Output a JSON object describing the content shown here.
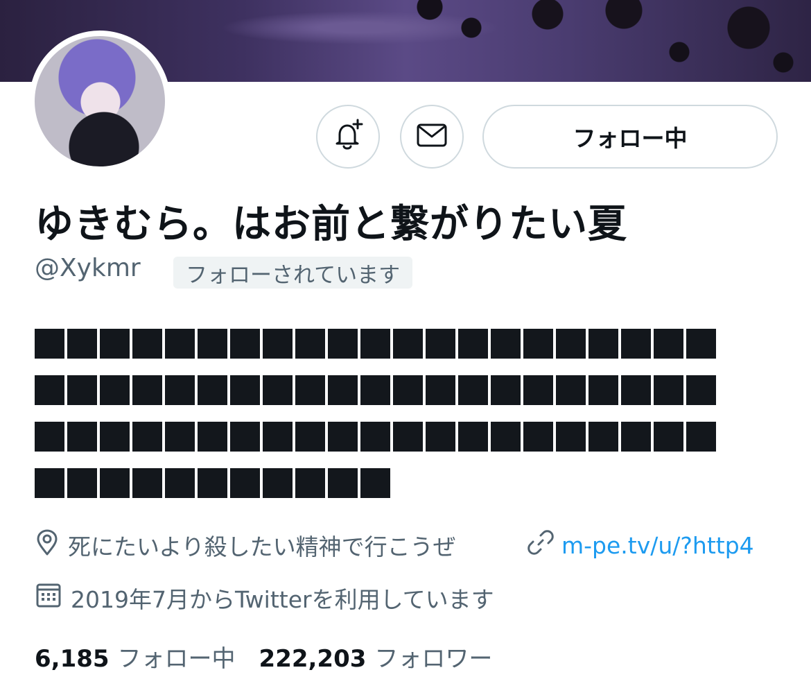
{
  "profile": {
    "display_name": "ゆきむら。はお前と繋がりたい夏",
    "handle": "@Xykmr",
    "follows_you_badge": "フォローされています",
    "bio_redacted_lines": [
      21,
      21,
      21,
      11
    ],
    "location": "死にたいより殺したい精神で行こうぜ",
    "url": "m-pe.tv/u/?http4",
    "joined": "2019年7月からTwitterを利用しています"
  },
  "actions": {
    "follow_label": "フォロー中",
    "bell_icon": "bell-plus-icon",
    "mail_icon": "envelope-icon"
  },
  "stats": {
    "following_count": "6,185",
    "following_label": "フォロー中",
    "followers_count": "222,203",
    "followers_label": "フォロワー"
  },
  "colors": {
    "link": "#1d9bf0",
    "secondary_text": "#536471",
    "border": "#cfd9de",
    "badge_bg": "#eff3f4"
  }
}
